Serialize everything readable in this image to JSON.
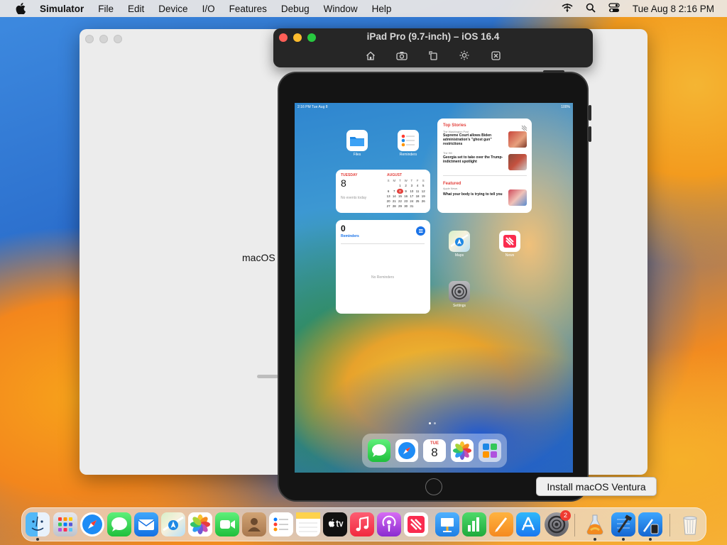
{
  "menubar": {
    "app_name": "Simulator",
    "items": [
      "File",
      "Edit",
      "Device",
      "I/O",
      "Features",
      "Debug",
      "Window",
      "Help"
    ],
    "clock": "Tue Aug 8  2:16 PM"
  },
  "back_window": {
    "label": "macOS"
  },
  "simulator": {
    "title": "iPad Pro (9.7-inch) – iOS 16.4",
    "toolbar_icons": [
      "home-icon",
      "screenshot-icon",
      "rotate-icon",
      "appearance-icon",
      "close-icon"
    ]
  },
  "ipad": {
    "status_time": "2:16 PM  Tue Aug 8",
    "status_battery": "100%",
    "apps": [
      {
        "label": "Files",
        "icon": "files-icon"
      },
      {
        "label": "Reminders",
        "icon": "reminders-icon"
      },
      {
        "label": "Maps",
        "icon": "maps-icon"
      },
      {
        "label": "News",
        "icon": "news-icon"
      },
      {
        "label": "Settings",
        "icon": "settings-icon"
      }
    ],
    "calendar_widget": {
      "day_label": "TUESDAY",
      "day_number": "8",
      "no_events": "No events today",
      "month": "AUGUST",
      "weekday_headers": [
        "S",
        "M",
        "T",
        "W",
        "T",
        "F",
        "S"
      ],
      "weeks": [
        [
          "",
          "",
          "1",
          "2",
          "3",
          "4",
          "5"
        ],
        [
          "6",
          "7",
          "8",
          "9",
          "10",
          "11",
          "12"
        ],
        [
          "13",
          "14",
          "15",
          "16",
          "17",
          "18",
          "19"
        ],
        [
          "20",
          "21",
          "22",
          "23",
          "24",
          "25",
          "26"
        ],
        [
          "27",
          "28",
          "29",
          "30",
          "31",
          "",
          ""
        ]
      ]
    },
    "news_widget": {
      "header": "Top Stories",
      "story1_source": "The Washington Post",
      "story1": "Supreme Court allows Biden administration's \"ghost gun\" restrictions",
      "story2_source": "The Hill",
      "story2": "Georgia set to take over the Trump-indictment spotlight",
      "featured_header": "Featured",
      "featured_source": "Apple News",
      "featured_story": "What your body is trying to tell you"
    },
    "reminders_widget": {
      "count": "0",
      "title": "Reminders",
      "empty": "No Reminders"
    },
    "dock_apps": [
      "messages-icon",
      "safari-icon",
      "calendar-icon",
      "photos-icon",
      "app-library-icon"
    ],
    "dock_calendar": {
      "day": "TUE",
      "date": "8"
    }
  },
  "tooltip": "Install macOS Ventura",
  "dock": {
    "apps": [
      {
        "name": "finder-icon"
      },
      {
        "name": "launchpad-icon"
      },
      {
        "name": "safari-icon"
      },
      {
        "name": "messages-icon"
      },
      {
        "name": "mail-icon"
      },
      {
        "name": "maps-icon"
      },
      {
        "name": "photos-icon"
      },
      {
        "name": "facetime-icon"
      },
      {
        "name": "contacts-icon"
      },
      {
        "name": "reminders-icon"
      },
      {
        "name": "notes-icon"
      },
      {
        "name": "tv-icon"
      },
      {
        "name": "music-icon"
      },
      {
        "name": "podcasts-icon"
      },
      {
        "name": "news-icon"
      },
      {
        "name": "keynote-icon"
      },
      {
        "name": "numbers-icon"
      },
      {
        "name": "pages-icon"
      },
      {
        "name": "app-store-icon"
      },
      {
        "name": "system-settings-icon",
        "badge": "2"
      },
      {
        "name": "install-macos-ventura-icon"
      },
      {
        "name": "xcode-icon"
      },
      {
        "name": "simulator-icon"
      },
      {
        "name": "trash-icon"
      }
    ]
  }
}
